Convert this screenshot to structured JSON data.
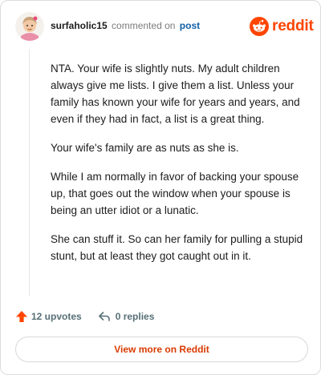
{
  "header": {
    "username": "surfaholic15",
    "action": "commented on",
    "post_link": "post",
    "brand": "reddit"
  },
  "comment": {
    "paragraphs": [
      "NTA. Your wife is slightly nuts. My adult children always give me lists. I give them a list. Unless your family has known your wife for years and years, and even if they had in fact, a list is a great thing.",
      "Your wife's family are as nuts as she is.",
      "While I am normally in favor of backing your spouse up, that goes out the window when your spouse is being an utter idiot or a lunatic.",
      "She can stuff it. So can her family for pulling a stupid stunt, but at least they got caught out in it."
    ]
  },
  "footer": {
    "upvotes": "12 upvotes",
    "replies": "0 replies"
  },
  "cta": {
    "label": "View more on Reddit"
  },
  "colors": {
    "brand": "#ff4500",
    "link": "#0f5fa6",
    "cta_text": "#d93a00"
  },
  "icons": {
    "avatar": "cartoon-avatar",
    "logo": "reddit-snoo-icon",
    "upvote": "upvote-arrow-icon",
    "reply": "reply-arrow-icon"
  }
}
